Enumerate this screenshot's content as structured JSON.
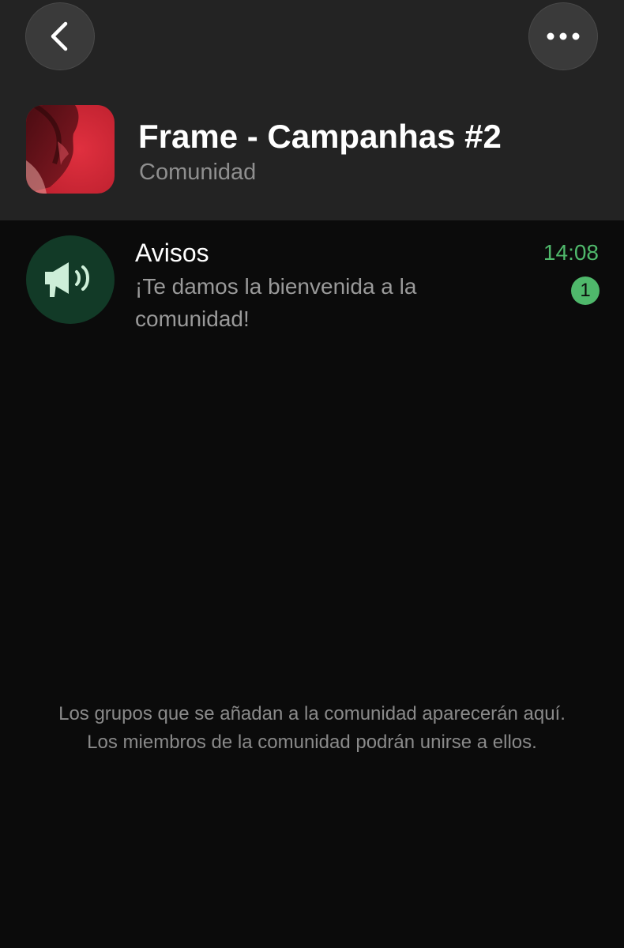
{
  "nav": {
    "back_icon": "chevron-left-icon",
    "more_icon": "ellipsis-icon"
  },
  "community": {
    "name": "Frame - Campanhas #2",
    "subtitle": "Comunidad"
  },
  "chats": [
    {
      "name": "Avisos",
      "icon": "megaphone-icon",
      "message": "¡Te damos la bienvenida a la comunidad!",
      "time": "14:08",
      "unread_count": "1"
    }
  ],
  "footer": {
    "line1": "Los grupos que se añadan a la comunidad aparecerán aquí.",
    "line2": "Los miembros de la comunidad podrán unirse a ellos."
  },
  "colors": {
    "accent": "#4fb86b",
    "header_bg": "#232323",
    "background": "#0b0b0b",
    "icon_circle_bg": "#123a27"
  }
}
